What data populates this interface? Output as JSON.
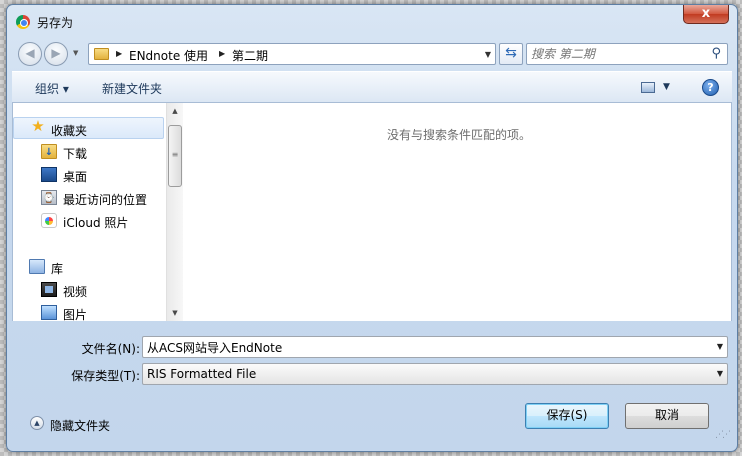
{
  "window": {
    "title": "另存为",
    "close_glyph": "x"
  },
  "address_bar": {
    "back_glyph": "◀",
    "forward_glyph": "▶",
    "crumbs": [
      "ENdnote 使用",
      "第二期"
    ],
    "search_placeholder": "搜索 第二期"
  },
  "toolbar": {
    "organize": "组织 ▾",
    "new_folder": "新建文件夹",
    "help_glyph": "?"
  },
  "nav": {
    "favorites_label": "收藏夹",
    "items": [
      {
        "label": "下载",
        "icon": "download-folder-icon"
      },
      {
        "label": "桌面",
        "icon": "desktop-icon"
      },
      {
        "label": "最近访问的位置",
        "icon": "recent-places-icon"
      },
      {
        "label": "iCloud 照片",
        "icon": "icloud-photos-icon"
      }
    ],
    "libraries_label": "库",
    "library_items": [
      {
        "label": "视频",
        "icon": "video-icon"
      },
      {
        "label": "图片",
        "icon": "pictures-icon"
      }
    ]
  },
  "content": {
    "empty_message": "没有与搜索条件匹配的项。"
  },
  "form": {
    "filename_label": "文件名(N):",
    "filename_value": "从ACS网站导入EndNote",
    "filetype_label": "保存类型(T):",
    "filetype_value": "RIS Formatted File"
  },
  "footer": {
    "hide_folders": "隐藏文件夹",
    "save_button": "保存(S)",
    "cancel_button": "取消"
  },
  "colors": {
    "frame": "#c7d9ee",
    "close": "#c13b21",
    "accent": "#3c7fb1"
  }
}
